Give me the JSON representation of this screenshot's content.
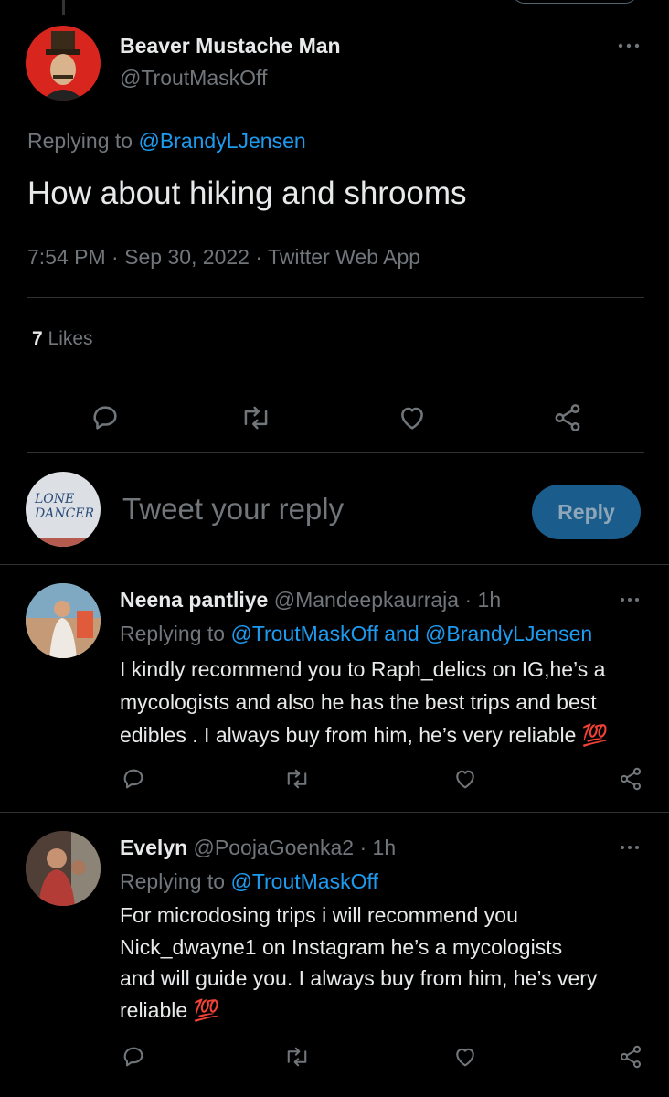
{
  "main_tweet": {
    "author_name": "Beaver Mustache Man",
    "author_handle": "@TroutMaskOff",
    "replying_prefix": "Replying to",
    "replying_to": "@BrandyLJensen",
    "text": "How about hiking and shrooms",
    "time": "7:54 PM",
    "sep1": "·",
    "date": "Sep 30, 2022",
    "sep2": "·",
    "source": "Twitter Web App",
    "likes_count": "7",
    "likes_label": "Likes"
  },
  "compose": {
    "avatar_text_line1": "LONE",
    "avatar_text_line2": "DANCER",
    "placeholder": "Tweet your reply",
    "reply_button": "Reply"
  },
  "replies": [
    {
      "name": "Neena pantliye",
      "handle": "@Mandeepkaurraja",
      "sep": "·",
      "age": "1h",
      "replying_prefix": "Replying to",
      "replying_to": "@TroutMaskOff and @BrandyLJensen",
      "lines": [
        "I kindly recommend you to Raph_delics on IG,he’s a",
        "mycologists and also he has the best trips and best",
        "edibles . I always buy from him, he’s very reliable 💯"
      ]
    },
    {
      "name": "Evelyn",
      "handle": "@PoojaGoenka2",
      "sep": "·",
      "age": "1h",
      "replying_prefix": "Replying to",
      "replying_to": "@TroutMaskOff",
      "lines": [
        "For microdosing trips i will recommend you",
        "Nick_dwayne1 on  Instagram he’s a mycologists",
        "and will guide you. I always buy from him, he’s very",
        "reliable 💯"
      ]
    }
  ],
  "icons": {
    "reply": "speech-bubble-icon",
    "retweet": "retweet-icon",
    "like": "heart-icon",
    "share": "share-icon",
    "more": "more-dots-icon"
  },
  "colors": {
    "background": "#000000",
    "text": "#e7e9ea",
    "muted": "#71767b",
    "link": "#1d9bf0",
    "reply_button": "#1a5d8c",
    "divider": "#2f3336"
  }
}
